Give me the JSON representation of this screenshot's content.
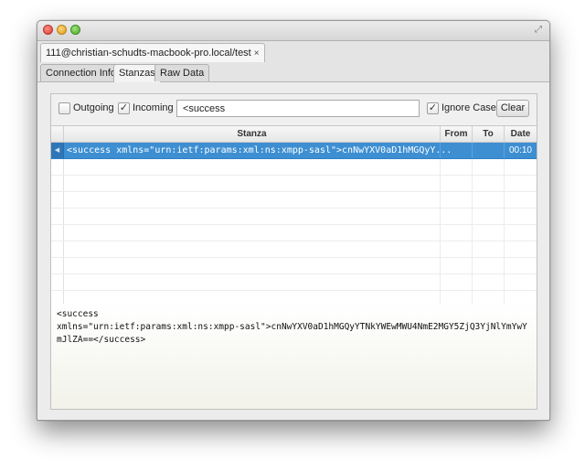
{
  "window": {
    "document_tab": "111@christian-schudts-macbook-pro.local/test",
    "document_tab_close": "×",
    "fullscreen_glyph": "⤢"
  },
  "tabs": [
    {
      "label": "Connection Info",
      "active": false
    },
    {
      "label": "Stanzas",
      "active": true
    },
    {
      "label": "Raw Data",
      "active": false
    }
  ],
  "filters": {
    "outgoing": {
      "label": "Outgoing",
      "checked": false
    },
    "incoming": {
      "label": "Incoming",
      "checked": true,
      "mark": "✓"
    },
    "search_value": "<success",
    "ignore_case": {
      "label": "Ignore Case",
      "checked": true,
      "mark": "✓"
    },
    "clear_label": "Clear"
  },
  "table": {
    "columns": [
      "Stanza",
      "From",
      "To",
      "Date"
    ],
    "rows": [
      {
        "marker": "◀",
        "stanza": "<success xmlns=\"urn:ietf:params:xml:ns:xmpp-sasl\">cnNwYXV0aD1hMGQyY...",
        "from": "",
        "to": "",
        "date": "00:10",
        "selected": true
      }
    ]
  },
  "detail": {
    "text": "<success\nxmlns=\"urn:ietf:params:xml:ns:xmpp-sasl\">cnNwYXV0aD1hMGQyYTNkYWEwMWU4NmE2MGY5ZjQ3YjNlYmYwYmJlZA==</success>"
  },
  "colors": {
    "selection": "#3d8fd2",
    "window_bg": "#ececec"
  }
}
